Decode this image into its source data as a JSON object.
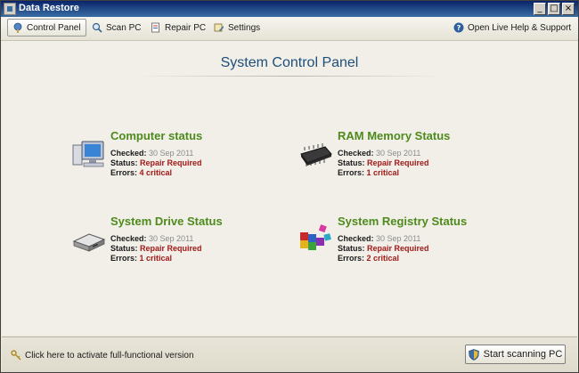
{
  "window": {
    "title": "Data Restore"
  },
  "toolbar": {
    "items": [
      {
        "label": "Control Panel"
      },
      {
        "label": "Scan PC"
      },
      {
        "label": "Repair PC"
      },
      {
        "label": "Settings"
      }
    ],
    "help_label": "Open Live Help & Support"
  },
  "main": {
    "title": "System Control Panel",
    "cards": [
      {
        "title": "Computer status",
        "checked_label": "Checked:",
        "checked": "30 Sep 2011",
        "status_label": "Status:",
        "status": "Repair Required",
        "errors_label": "Errors:",
        "errors": "4 critical",
        "icon": "computer-icon"
      },
      {
        "title": "RAM Memory Status",
        "checked_label": "Checked:",
        "checked": "30 Sep 2011",
        "status_label": "Status:",
        "status": "Repair Required",
        "errors_label": "Errors:",
        "errors": "1 critical",
        "icon": "ram-chip-icon"
      },
      {
        "title": "System Drive Status",
        "checked_label": "Checked:",
        "checked": "30 Sep 2011",
        "status_label": "Status:",
        "status": "Repair Required",
        "errors_label": "Errors:",
        "errors": "1 critical",
        "icon": "hard-drive-icon"
      },
      {
        "title": "System Registry Status",
        "checked_label": "Checked:",
        "checked": "30 Sep 2011",
        "status_label": "Status:",
        "status": "Repair Required",
        "errors_label": "Errors:",
        "errors": "2 critical",
        "icon": "registry-cubes-icon"
      }
    ]
  },
  "footer": {
    "activate_label": "Click here to activate full-functional version",
    "scan_button": "Start scanning PC"
  },
  "colors": {
    "title_text": "#1d4f7a",
    "card_title": "#4e8a1c",
    "error_text": "#a21919"
  }
}
